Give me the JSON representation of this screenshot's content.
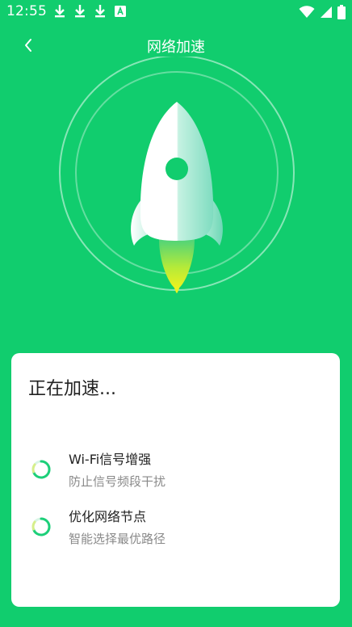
{
  "status_bar": {
    "time": "12:55",
    "left_icons": [
      "download-icon",
      "download-icon",
      "download-icon",
      "a-badge-icon"
    ],
    "right_icons": [
      "wifi-icon",
      "signal-icon",
      "battery-icon"
    ]
  },
  "header": {
    "title": "网络加速",
    "back_icon": "chevron-left-icon"
  },
  "card": {
    "title": "正在加速...",
    "items": [
      {
        "title": "Wi-Fi信号增强",
        "description": "防止信号频段干扰",
        "icon": "loading-spinner-icon"
      },
      {
        "title": "优化网络节点",
        "description": "智能选择最优路径",
        "icon": "loading-spinner-icon"
      }
    ]
  },
  "colors": {
    "background": "#11cd6e",
    "card": "#ffffff",
    "title_text": "#222222",
    "secondary_text": "#8a8a8a"
  }
}
